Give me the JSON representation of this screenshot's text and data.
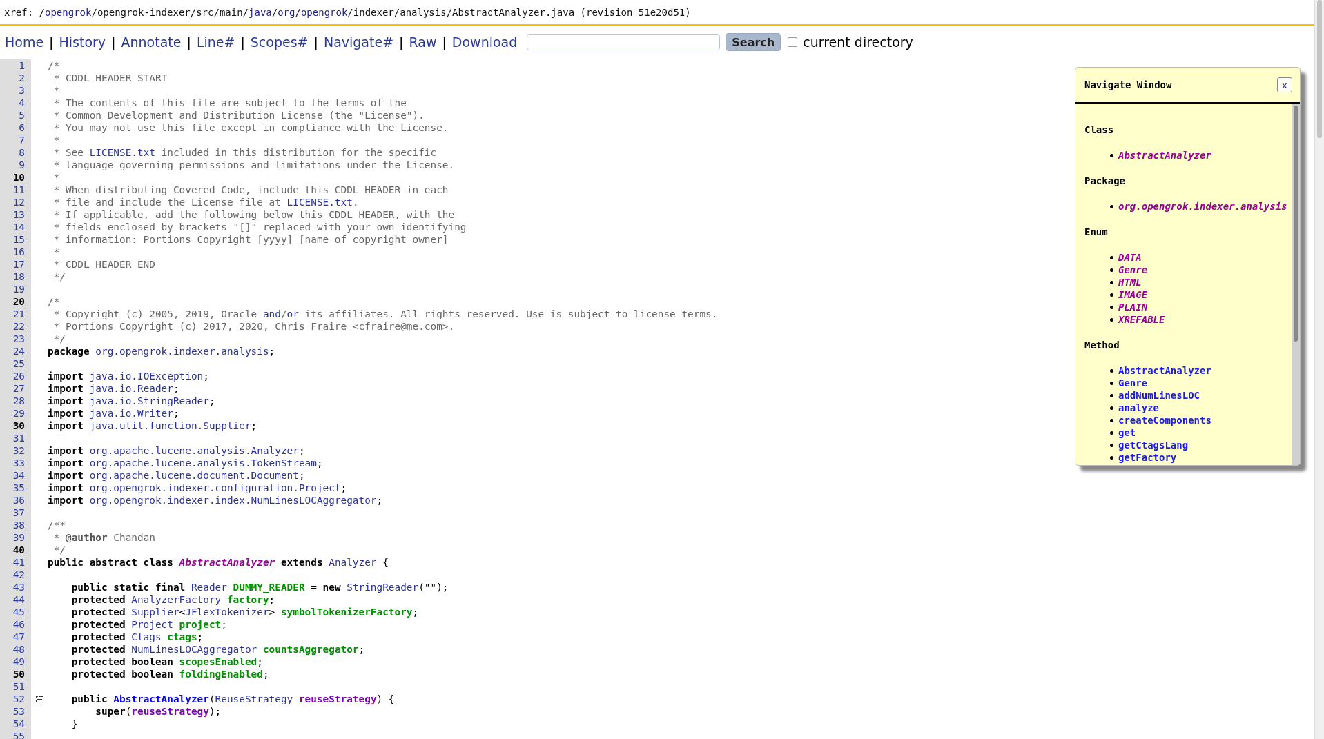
{
  "xref": {
    "label": "xref: ",
    "path": [
      {
        "text": "/",
        "kind": "plain"
      },
      {
        "text": "opengrok",
        "kind": "link"
      },
      {
        "text": "/opengrok-indexer/src/main/",
        "kind": "plain"
      },
      {
        "text": "java",
        "kind": "link"
      },
      {
        "text": "/",
        "kind": "plain"
      },
      {
        "text": "org",
        "kind": "link"
      },
      {
        "text": "/",
        "kind": "plain"
      },
      {
        "text": "opengrok",
        "kind": "link"
      },
      {
        "text": "/indexer/analysis/AbstractAnalyzer.java",
        "kind": "plain"
      }
    ],
    "revision": " (revision 51e20d51)"
  },
  "menu": [
    {
      "text": "Home",
      "kind": "link"
    },
    {
      "text": "|",
      "kind": "separator"
    },
    {
      "text": "History",
      "kind": "link"
    },
    {
      "text": "|",
      "kind": "separator"
    },
    {
      "text": "Annotate",
      "kind": "link"
    },
    {
      "text": "|",
      "kind": "separator"
    },
    {
      "text": "Line#",
      "kind": "link"
    },
    {
      "text": "|",
      "kind": "separator"
    },
    {
      "text": "Scopes#",
      "kind": "link"
    },
    {
      "text": "|",
      "kind": "separator"
    },
    {
      "text": "Navigate#",
      "kind": "link"
    },
    {
      "text": "|",
      "kind": "separator"
    },
    {
      "text": "Raw",
      "kind": "link"
    },
    {
      "text": "|",
      "kind": "separator"
    },
    {
      "text": "Download",
      "kind": "link"
    }
  ],
  "search": {
    "button": "Search",
    "checkbox": {
      "label": "current directory",
      "checked": false
    }
  },
  "code_lines": [
    {
      "number": "1",
      "major": false,
      "tokens": [
        {
          "kind": "comment",
          "text": "/*"
        }
      ]
    },
    {
      "number": "2",
      "major": false,
      "tokens": [
        {
          "kind": "comment",
          "text": " * CDDL HEADER START"
        }
      ]
    },
    {
      "number": "3",
      "major": false,
      "tokens": [
        {
          "kind": "comment",
          "text": " *"
        }
      ]
    },
    {
      "number": "4",
      "major": false,
      "tokens": [
        {
          "kind": "comment",
          "text": " * The contents of this file are subject to the terms of the"
        }
      ]
    },
    {
      "number": "5",
      "major": false,
      "tokens": [
        {
          "kind": "comment",
          "text": " * Common Development and Distribution License (the \"License\")."
        }
      ]
    },
    {
      "number": "6",
      "major": false,
      "tokens": [
        {
          "kind": "comment",
          "text": " * You may not use this file except in compliance with the License."
        }
      ]
    },
    {
      "number": "7",
      "major": false,
      "tokens": [
        {
          "kind": "comment",
          "text": " *"
        }
      ]
    },
    {
      "number": "8",
      "major": false,
      "tokens": [
        {
          "kind": "comment",
          "text": " * See "
        },
        {
          "kind": "link",
          "text": "LICENSE.txt"
        },
        {
          "kind": "comment",
          "text": " included in this distribution for the specific"
        }
      ]
    },
    {
      "number": "9",
      "major": false,
      "tokens": [
        {
          "kind": "comment",
          "text": " * language governing permissions and limitations under the License."
        }
      ]
    },
    {
      "number": "10",
      "major": true,
      "tokens": [
        {
          "kind": "comment",
          "text": " *"
        }
      ]
    },
    {
      "number": "11",
      "major": false,
      "tokens": [
        {
          "kind": "comment",
          "text": " * When distributing Covered Code, include this CDDL HEADER in each"
        }
      ]
    },
    {
      "number": "12",
      "major": false,
      "tokens": [
        {
          "kind": "comment",
          "text": " * file and include the License file at "
        },
        {
          "kind": "link",
          "text": "LICENSE.txt"
        },
        {
          "kind": "comment",
          "text": "."
        }
      ]
    },
    {
      "number": "13",
      "major": false,
      "tokens": [
        {
          "kind": "comment",
          "text": " * If applicable, add the following below this CDDL HEADER, with the"
        }
      ]
    },
    {
      "number": "14",
      "major": false,
      "tokens": [
        {
          "kind": "comment",
          "text": " * fields enclosed by brackets \"[]\" replaced with your own identifying"
        }
      ]
    },
    {
      "number": "15",
      "major": false,
      "tokens": [
        {
          "kind": "comment",
          "text": " * information: Portions Copyright [yyyy] [name of copyright owner]"
        }
      ]
    },
    {
      "number": "16",
      "major": false,
      "tokens": [
        {
          "kind": "comment",
          "text": " *"
        }
      ]
    },
    {
      "number": "17",
      "major": false,
      "tokens": [
        {
          "kind": "comment",
          "text": " * CDDL HEADER END"
        }
      ]
    },
    {
      "number": "18",
      "major": false,
      "tokens": [
        {
          "kind": "comment",
          "text": " */"
        }
      ]
    },
    {
      "number": "19",
      "major": false
    },
    {
      "number": "20",
      "major": true,
      "tokens": [
        {
          "kind": "comment",
          "text": "/*"
        }
      ]
    },
    {
      "number": "21",
      "major": false,
      "tokens": [
        {
          "kind": "comment",
          "text": " * Copyright (c) 2005, 2019, Oracle "
        },
        {
          "kind": "link",
          "text": "and"
        },
        {
          "kind": "comment",
          "text": "/"
        },
        {
          "kind": "link",
          "text": "or"
        },
        {
          "kind": "comment",
          "text": " its affiliates. All rights reserved. Use is subject to license terms."
        }
      ]
    },
    {
      "number": "22",
      "major": false,
      "tokens": [
        {
          "kind": "comment",
          "text": " * Portions Copyright (c) 2017, 2020, Chris Fraire <cfraire@me.com>."
        }
      ]
    },
    {
      "number": "23",
      "major": false,
      "tokens": [
        {
          "kind": "comment",
          "text": " */"
        }
      ]
    },
    {
      "number": "24",
      "major": false,
      "tokens": [
        {
          "kind": "keyword",
          "text": "package "
        },
        {
          "kind": "link",
          "text": "org.opengrok.indexer.analysis"
        },
        {
          "kind": "plain",
          "text": ";"
        }
      ]
    },
    {
      "number": "25",
      "major": false
    },
    {
      "number": "26",
      "major": false,
      "tokens": [
        {
          "kind": "keyword",
          "text": "import "
        },
        {
          "kind": "link",
          "text": "java.io.IOException"
        },
        {
          "kind": "plain",
          "text": ";"
        }
      ]
    },
    {
      "number": "27",
      "major": false,
      "tokens": [
        {
          "kind": "keyword",
          "text": "import "
        },
        {
          "kind": "link",
          "text": "java.io.Reader"
        },
        {
          "kind": "plain",
          "text": ";"
        }
      ]
    },
    {
      "number": "28",
      "major": false,
      "tokens": [
        {
          "kind": "keyword",
          "text": "import "
        },
        {
          "kind": "link",
          "text": "java.io.StringReader"
        },
        {
          "kind": "plain",
          "text": ";"
        }
      ]
    },
    {
      "number": "29",
      "major": false,
      "tokens": [
        {
          "kind": "keyword",
          "text": "import "
        },
        {
          "kind": "link",
          "text": "java.io.Writer"
        },
        {
          "kind": "plain",
          "text": ";"
        }
      ]
    },
    {
      "number": "30",
      "major": true,
      "tokens": [
        {
          "kind": "keyword",
          "text": "import "
        },
        {
          "kind": "link",
          "text": "java.util.function.Supplier"
        },
        {
          "kind": "plain",
          "text": ";"
        }
      ]
    },
    {
      "number": "31",
      "major": false
    },
    {
      "number": "32",
      "major": false,
      "tokens": [
        {
          "kind": "keyword",
          "text": "import "
        },
        {
          "kind": "link",
          "text": "org.apache.lucene.analysis.Analyzer"
        },
        {
          "kind": "plain",
          "text": ";"
        }
      ]
    },
    {
      "number": "33",
      "major": false,
      "tokens": [
        {
          "kind": "keyword",
          "text": "import "
        },
        {
          "kind": "link",
          "text": "org.apache.lucene.analysis.TokenStream"
        },
        {
          "kind": "plain",
          "text": ";"
        }
      ]
    },
    {
      "number": "34",
      "major": false,
      "tokens": [
        {
          "kind": "keyword",
          "text": "import "
        },
        {
          "kind": "link",
          "text": "org.apache.lucene.document.Document"
        },
        {
          "kind": "plain",
          "text": ";"
        }
      ]
    },
    {
      "number": "35",
      "major": false,
      "tokens": [
        {
          "kind": "keyword",
          "text": "import "
        },
        {
          "kind": "link",
          "text": "org.opengrok.indexer.configuration.Project"
        },
        {
          "kind": "plain",
          "text": ";"
        }
      ]
    },
    {
      "number": "36",
      "major": false,
      "tokens": [
        {
          "kind": "keyword",
          "text": "import "
        },
        {
          "kind": "link",
          "text": "org.opengrok.indexer.index.NumLinesLOCAggregator"
        },
        {
          "kind": "plain",
          "text": ";"
        }
      ]
    },
    {
      "number": "37",
      "major": false
    },
    {
      "number": "38",
      "major": false,
      "tokens": [
        {
          "kind": "comment",
          "text": "/**"
        }
      ]
    },
    {
      "number": "39",
      "major": false,
      "tokens": [
        {
          "kind": "comment",
          "text": " * "
        },
        {
          "kind": "doctag",
          "text": "@author"
        },
        {
          "kind": "comment",
          "text": " Chandan"
        }
      ]
    },
    {
      "number": "40",
      "major": true,
      "tokens": [
        {
          "kind": "comment",
          "text": " */"
        }
      ]
    },
    {
      "number": "41",
      "major": false,
      "tokens": [
        {
          "kind": "keyword",
          "text": "public abstract class "
        },
        {
          "kind": "classdef",
          "text": "AbstractAnalyzer"
        },
        {
          "kind": "keyword",
          "text": " extends "
        },
        {
          "kind": "link",
          "text": "Analyzer"
        },
        {
          "kind": "plain",
          "text": " {"
        }
      ]
    },
    {
      "number": "42",
      "major": false
    },
    {
      "number": "43",
      "major": false,
      "tokens": [
        {
          "kind": "keyword",
          "text": "    public static final "
        },
        {
          "kind": "link",
          "text": "Reader"
        },
        {
          "kind": "field",
          "text": " DUMMY_READER"
        },
        {
          "kind": "plain",
          "text": " = "
        },
        {
          "kind": "keyword",
          "text": "new "
        },
        {
          "kind": "link",
          "text": "StringReader"
        },
        {
          "kind": "plain",
          "text": "(\"\");"
        }
      ]
    },
    {
      "number": "44",
      "major": false,
      "tokens": [
        {
          "kind": "keyword",
          "text": "    protected "
        },
        {
          "kind": "link",
          "text": "AnalyzerFactory"
        },
        {
          "kind": "field",
          "text": " factory"
        },
        {
          "kind": "plain",
          "text": ";"
        }
      ]
    },
    {
      "number": "45",
      "major": false,
      "tokens": [
        {
          "kind": "keyword",
          "text": "    protected "
        },
        {
          "kind": "link",
          "text": "Supplier"
        },
        {
          "kind": "plain",
          "text": "<"
        },
        {
          "kind": "link",
          "text": "JFlexTokenizer"
        },
        {
          "kind": "plain",
          "text": ">"
        },
        {
          "kind": "field",
          "text": " symbolTokenizerFactory"
        },
        {
          "kind": "plain",
          "text": ";"
        }
      ]
    },
    {
      "number": "46",
      "major": false,
      "tokens": [
        {
          "kind": "keyword",
          "text": "    protected "
        },
        {
          "kind": "link",
          "text": "Project"
        },
        {
          "kind": "field",
          "text": " project"
        },
        {
          "kind": "plain",
          "text": ";"
        }
      ]
    },
    {
      "number": "47",
      "major": false,
      "tokens": [
        {
          "kind": "keyword",
          "text": "    protected "
        },
        {
          "kind": "link",
          "text": "Ctags"
        },
        {
          "kind": "field",
          "text": " ctags"
        },
        {
          "kind": "plain",
          "text": ";"
        }
      ]
    },
    {
      "number": "48",
      "major": false,
      "tokens": [
        {
          "kind": "keyword",
          "text": "    protected "
        },
        {
          "kind": "link",
          "text": "NumLinesLOCAggregator"
        },
        {
          "kind": "field",
          "text": " countsAggregator"
        },
        {
          "kind": "plain",
          "text": ";"
        }
      ]
    },
    {
      "number": "49",
      "major": false,
      "tokens": [
        {
          "kind": "keyword",
          "text": "    protected boolean "
        },
        {
          "kind": "field",
          "text": "scopesEnabled"
        },
        {
          "kind": "plain",
          "text": ";"
        }
      ]
    },
    {
      "number": "50",
      "major": true,
      "tokens": [
        {
          "kind": "keyword",
          "text": "    protected boolean "
        },
        {
          "kind": "field",
          "text": "foldingEnabled"
        },
        {
          "kind": "plain",
          "text": ";"
        }
      ]
    },
    {
      "number": "51",
      "major": false
    },
    {
      "number": "52",
      "major": false,
      "fold": true,
      "tokens": [
        {
          "kind": "keyword",
          "text": "    public "
        },
        {
          "kind": "methoddef",
          "text": "AbstractAnalyzer"
        },
        {
          "kind": "plain",
          "text": "("
        },
        {
          "kind": "link",
          "text": "ReuseStrategy"
        },
        {
          "kind": "param",
          "text": " reuseStrategy"
        },
        {
          "kind": "plain",
          "text": ") {"
        }
      ]
    },
    {
      "number": "53",
      "major": false,
      "tokens": [
        {
          "kind": "keyword",
          "text": "        super"
        },
        {
          "kind": "plain",
          "text": "("
        },
        {
          "kind": "param",
          "text": "reuseStrategy"
        },
        {
          "kind": "plain",
          "text": ");"
        }
      ]
    },
    {
      "number": "54",
      "major": false,
      "tokens": [
        {
          "kind": "plain",
          "text": "    }"
        }
      ]
    },
    {
      "number": "55",
      "major": false
    }
  ],
  "navigate_window": {
    "title": "Navigate Window",
    "close": "x",
    "sections": [
      {
        "title": "Class",
        "items": [
          {
            "text": "AbstractAnalyzer",
            "kind": "class"
          }
        ]
      },
      {
        "title": "Package",
        "items": [
          {
            "text": "org.opengrok.indexer.analysis",
            "kind": "package"
          }
        ]
      },
      {
        "title": "Enum",
        "items": [
          {
            "text": "DATA",
            "kind": "enum"
          },
          {
            "text": "Genre",
            "kind": "enum"
          },
          {
            "text": "HTML",
            "kind": "enum"
          },
          {
            "text": "IMAGE",
            "kind": "enum"
          },
          {
            "text": "PLAIN",
            "kind": "enum"
          },
          {
            "text": "XREFABLE",
            "kind": "enum"
          }
        ]
      },
      {
        "title": "Method",
        "items": [
          {
            "text": "AbstractAnalyzer",
            "kind": "method"
          },
          {
            "text": "Genre",
            "kind": "method"
          },
          {
            "text": "addNumLinesLOC",
            "kind": "method"
          },
          {
            "text": "analyze",
            "kind": "method"
          },
          {
            "text": "createComponents",
            "kind": "method"
          },
          {
            "text": "get",
            "kind": "method"
          },
          {
            "text": "getCtagsLang",
            "kind": "method"
          },
          {
            "text": "getFactory",
            "kind": "method"
          }
        ]
      }
    ]
  }
}
